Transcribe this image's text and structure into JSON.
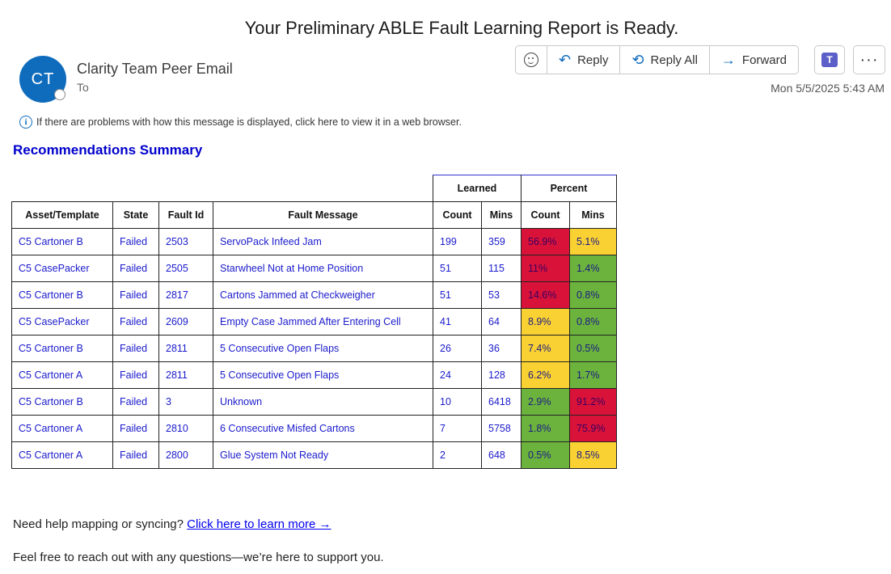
{
  "email": {
    "subject": "Your Preliminary ABLE Fault Learning Report is Ready.",
    "avatar_initials": "CT",
    "sender": "Clarity Team Peer Email",
    "to_label": "To",
    "date": "Mon 5/5/2025 5:43 AM",
    "info_text": "If there are problems with how this message is displayed, click here to view it in a web browser."
  },
  "actions": {
    "reply": "Reply",
    "reply_all": "Reply All",
    "forward": "Forward",
    "more": "···",
    "teams_letter": "T"
  },
  "report": {
    "heading": "Recommendations Summary",
    "group_learned": "Learned",
    "group_percent": "Percent",
    "headers": [
      "Asset/Template",
      "State",
      "Fault Id",
      "Fault Message",
      "Count",
      "Mins",
      "Count",
      "Mins"
    ],
    "rows": [
      {
        "asset": "C5 Cartoner B",
        "state": "Failed",
        "fault_id": "2503",
        "message": "ServoPack Infeed Jam",
        "count": "199",
        "mins": "359",
        "pct_count": "56.9%",
        "pct_count_color": "red",
        "pct_mins": "5.1%",
        "pct_mins_color": "yellow"
      },
      {
        "asset": "C5 CasePacker",
        "state": "Failed",
        "fault_id": "2505",
        "message": "Starwheel Not at Home Position",
        "count": "51",
        "mins": "115",
        "pct_count": "11%",
        "pct_count_color": "red",
        "pct_mins": "1.4%",
        "pct_mins_color": "green"
      },
      {
        "asset": "C5 Cartoner B",
        "state": "Failed",
        "fault_id": "2817",
        "message": "Cartons Jammed at Checkweigher",
        "count": "51",
        "mins": "53",
        "pct_count": "14.6%",
        "pct_count_color": "red",
        "pct_mins": "0.8%",
        "pct_mins_color": "green"
      },
      {
        "asset": "C5 CasePacker",
        "state": "Failed",
        "fault_id": "2609",
        "message": "Empty Case Jammed After Entering Cell",
        "count": "41",
        "mins": "64",
        "pct_count": "8.9%",
        "pct_count_color": "yellow",
        "pct_mins": "0.8%",
        "pct_mins_color": "green"
      },
      {
        "asset": "C5 Cartoner B",
        "state": "Failed",
        "fault_id": "2811",
        "message": "5 Consecutive Open Flaps",
        "count": "26",
        "mins": "36",
        "pct_count": "7.4%",
        "pct_count_color": "yellow",
        "pct_mins": "0.5%",
        "pct_mins_color": "green"
      },
      {
        "asset": "C5 Cartoner A",
        "state": "Failed",
        "fault_id": "2811",
        "message": "5 Consecutive Open Flaps",
        "count": "24",
        "mins": "128",
        "pct_count": "6.2%",
        "pct_count_color": "yellow",
        "pct_mins": "1.7%",
        "pct_mins_color": "green"
      },
      {
        "asset": "C5 Cartoner B",
        "state": "Failed",
        "fault_id": "3",
        "message": "Unknown",
        "count": "10",
        "mins": "6418",
        "pct_count": "2.9%",
        "pct_count_color": "green",
        "pct_mins": "91.2%",
        "pct_mins_color": "red"
      },
      {
        "asset": "C5 Cartoner A",
        "state": "Failed",
        "fault_id": "2810",
        "message": "6 Consecutive Misfed Cartons",
        "count": "7",
        "mins": "5758",
        "pct_count": "1.8%",
        "pct_count_color": "green",
        "pct_mins": "75.9%",
        "pct_mins_color": "red"
      },
      {
        "asset": "C5 Cartoner A",
        "state": "Failed",
        "fault_id": "2800",
        "message": "Glue System Not Ready",
        "count": "2",
        "mins": "648",
        "pct_count": "0.5%",
        "pct_count_color": "green",
        "pct_mins": "8.5%",
        "pct_mins_color": "yellow"
      }
    ]
  },
  "footer": {
    "help_text": "Need help mapping or syncing?",
    "help_link": "Click here to learn more →",
    "closing": "Feel free to reach out with any questions—we’re here to support you."
  },
  "colors": {
    "red": "#d9123a",
    "yellow": "#f9d133",
    "green": "#6cb33e",
    "link_blue": "#0000cc",
    "accent": "#0f6cbd"
  }
}
